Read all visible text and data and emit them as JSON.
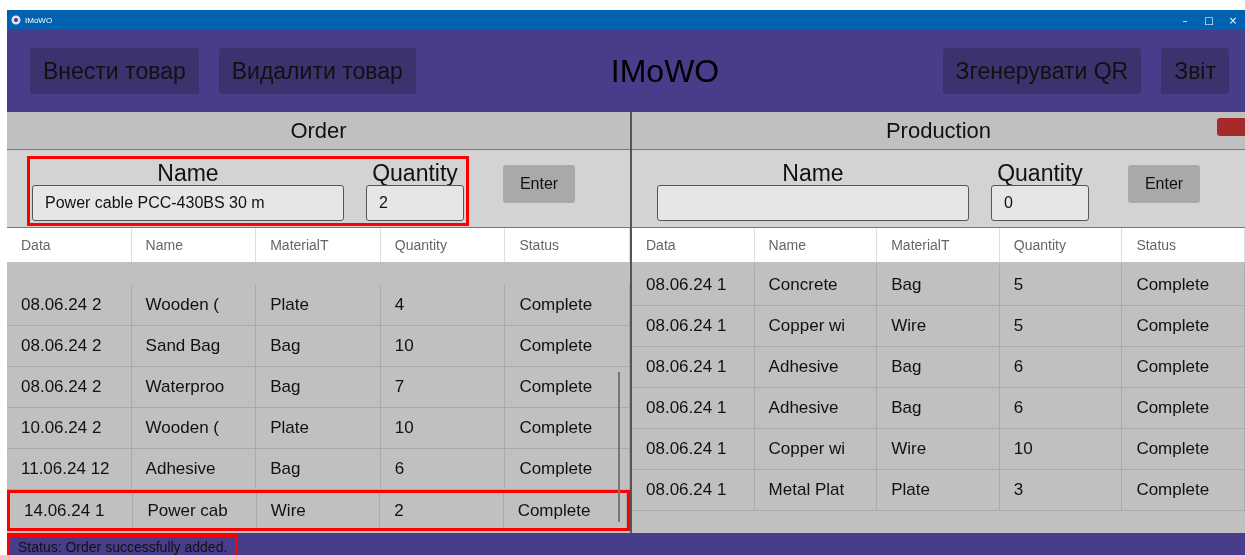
{
  "window": {
    "title": "IMoWO",
    "controls": [
      "–",
      "□",
      "×"
    ]
  },
  "toolbar": {
    "left_buttons": [
      "Внести товар",
      "Видалити товар"
    ],
    "app_title": "IMoWO",
    "right_buttons": [
      "Згенерувати QR",
      "Звіт"
    ]
  },
  "panels": [
    {
      "title": "Order",
      "indicator": false,
      "form": {
        "name_label": "Name",
        "quantity_label": "Quantity",
        "name_value": "Power cable PCC-430BS 30 m",
        "quantity_value": "2",
        "button": "Enter",
        "highlighted": true
      },
      "columns": [
        "Data",
        "Name",
        "MaterialT",
        "Quantity",
        "Status"
      ],
      "scrollbar": true,
      "rows": [
        {
          "cells": [
            "08.06.24 2",
            "Wooden (",
            "Plate",
            "4",
            "Complete"
          ],
          "highlighted": false
        },
        {
          "cells": [
            "08.06.24 2",
            "Sand Bag",
            "Bag",
            "10",
            "Complete"
          ],
          "highlighted": false
        },
        {
          "cells": [
            "08.06.24 2",
            "Waterproo",
            "Bag",
            "7",
            "Complete"
          ],
          "highlighted": false
        },
        {
          "cells": [
            "10.06.24 2",
            "Wooden (",
            "Plate",
            "10",
            "Complete"
          ],
          "highlighted": false
        },
        {
          "cells": [
            "11.06.24 12",
            "Adhesive",
            "Bag",
            "6",
            "Complete"
          ],
          "highlighted": false
        },
        {
          "cells": [
            "14.06.24 1",
            "Power cab",
            "Wire",
            "2",
            "Complete"
          ],
          "highlighted": true
        }
      ]
    },
    {
      "title": "Production",
      "indicator": true,
      "form": {
        "name_label": "Name",
        "quantity_label": "Quantity",
        "quantity_value": "0",
        "button": "Enter",
        "highlighted": false
      },
      "columns": [
        "Data",
        "Name",
        "MaterialT",
        "Quantity",
        "Status"
      ],
      "scrollbar": false,
      "rows": [
        {
          "cells": [
            "08.06.24 1",
            "Concrete",
            "Bag",
            "5",
            "Complete"
          ],
          "highlighted": false
        },
        {
          "cells": [
            "08.06.24 1",
            "Copper wi",
            "Wire",
            "5",
            "Complete"
          ],
          "highlighted": false
        },
        {
          "cells": [
            "08.06.24 1",
            "Adhesive",
            "Bag",
            "6",
            "Complete"
          ],
          "highlighted": false
        },
        {
          "cells": [
            "08.06.24 1",
            "Adhesive",
            "Bag",
            "6",
            "Complete"
          ],
          "highlighted": false
        },
        {
          "cells": [
            "08.06.24 1",
            "Copper wi",
            "Wire",
            "10",
            "Complete"
          ],
          "highlighted": false
        },
        {
          "cells": [
            "08.06.24 1",
            "Metal Plat",
            "Plate",
            "3",
            "Complete"
          ],
          "highlighted": false
        }
      ]
    }
  ],
  "status_bar": {
    "text": "Status: Order successfully added.",
    "highlighted": true
  }
}
